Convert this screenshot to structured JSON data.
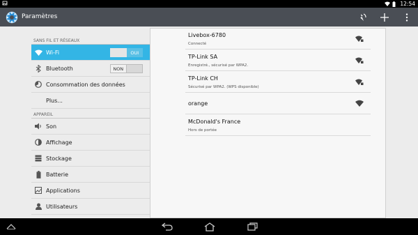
{
  "statusbar": {
    "time": "12:54"
  },
  "actionbar": {
    "title": "Paramètres"
  },
  "sidebar": {
    "sections": [
      {
        "header": "SANS FIL ET RÉSEAUX"
      },
      {
        "header": "APPAREIL"
      }
    ],
    "items": [
      {
        "label": "Wi-Fi",
        "icon": "wifi-icon",
        "toggle": "OUI",
        "selected": true
      },
      {
        "label": "Bluetooth",
        "icon": "bluetooth-icon",
        "toggle": "NON"
      },
      {
        "label": "Consommation des données",
        "icon": "data-usage-icon"
      },
      {
        "label": "Plus...",
        "icon": ""
      },
      {
        "label": "Son",
        "icon": "volume-icon"
      },
      {
        "label": "Affichage",
        "icon": "brightness-icon"
      },
      {
        "label": "Stockage",
        "icon": "storage-icon"
      },
      {
        "label": "Batterie",
        "icon": "battery-icon"
      },
      {
        "label": "Applications",
        "icon": "apps-icon"
      },
      {
        "label": "Utilisateurs",
        "icon": "user-icon"
      }
    ]
  },
  "networks": [
    {
      "name": "Livebox-6780",
      "status": "Connecté",
      "locked": true
    },
    {
      "name": "TP-Link SA",
      "status": "Enregistré., sécurisé par WPA2.",
      "locked": true
    },
    {
      "name": "TP-Link CH",
      "status": "Sécurisé par WPA2. (WPS disponible)",
      "locked": true
    },
    {
      "name": "orange",
      "status": "",
      "locked": false
    },
    {
      "name": "McDonald's France",
      "status": "Hors de portée",
      "locked": false
    }
  ],
  "colors": {
    "accent": "#33b5e5",
    "actionbar": "#4a4e55"
  }
}
